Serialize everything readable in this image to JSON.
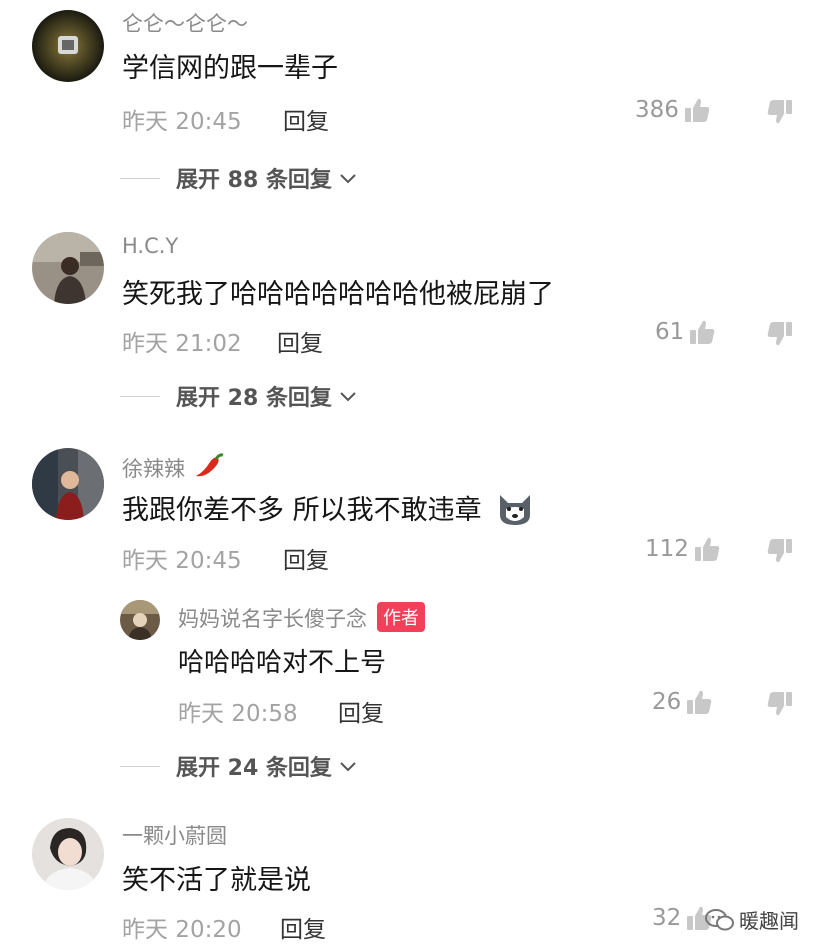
{
  "comments": [
    {
      "username": "仑仑～仑仑～",
      "text": "学信网的跟一辈子",
      "time": "昨天 20:45",
      "reply_label": "回复",
      "likes": "386",
      "expand_label": "展开 88 条回复"
    },
    {
      "username": "H.C.Y",
      "text": "笑死我了哈哈哈哈哈哈哈他被屁崩了",
      "time": "昨天 21:02",
      "reply_label": "回复",
      "likes": "61",
      "expand_label": "展开 28 条回复"
    },
    {
      "username": "徐辣辣",
      "text": "我跟你差不多 所以我不敢违章",
      "time": "昨天 20:45",
      "reply_label": "回复",
      "likes": "112",
      "reply": {
        "username": "妈妈说名字长傻子念",
        "badge": "作者",
        "text": "哈哈哈哈对不上号",
        "time": "昨天 20:58",
        "reply_label": "回复",
        "likes": "26"
      },
      "expand_label": "展开 24 条回复"
    },
    {
      "username": "一颗小蔚圆",
      "text": "笑不活了就是说",
      "time": "昨天 20:20",
      "reply_label": "回复",
      "likes": "32"
    }
  ],
  "watermark": "暖趣闻",
  "icons": {
    "like": "thumb-up-icon",
    "dislike": "thumb-down-icon",
    "expand": "chevron-down-icon",
    "chili": "chili-pepper-emoji",
    "dog": "husky-dog-emoji"
  }
}
